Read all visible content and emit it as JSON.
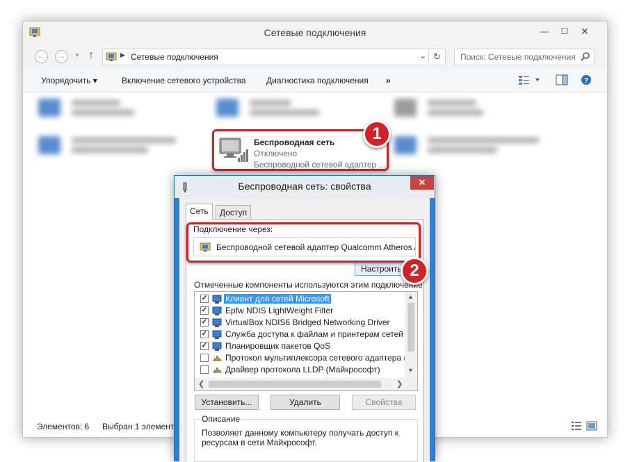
{
  "window": {
    "title": "Сетевые подключения",
    "minimize": "—",
    "maximize": "☐",
    "close": "✕"
  },
  "address": {
    "path": "Сетевые подключения",
    "search_placeholder": "Поиск: Сетевые подключения"
  },
  "toolbar": {
    "organize": "Упорядочить ▾",
    "enable_device": "Включение сетевого устройства",
    "diagnostics": "Диагностика подключения",
    "more": "»"
  },
  "selected_connection": {
    "name": "Беспроводная сеть",
    "status": "Отключено",
    "adapter": "Беспроводной сетевой адаптер ..."
  },
  "status_bar": {
    "count": "Элементов: 6",
    "selected": "Выбран 1 элемент"
  },
  "annotations": {
    "badge_1": "1",
    "badge_2": "2",
    "highlight_color": "#d32128"
  },
  "dialog": {
    "title": "Беспроводная сеть: свойства",
    "close": "✕",
    "tabs": [
      "Сеть",
      "Доступ"
    ],
    "connect_using_label": "Подключение через:",
    "adapter_name": "Беспроводной сетевой адаптер Qualcomm Atheros AR!",
    "configure_button": "Настроить...",
    "components_label": "Отмеченные компоненты используются этим подключением:",
    "components": [
      {
        "label": "Клиент для сетей Microsoft",
        "checked": true,
        "selected": true
      },
      {
        "label": "Epfw NDIS LightWeight Filter",
        "checked": true,
        "selected": false
      },
      {
        "label": "VirtualBox NDIS6 Bridged Networking Driver",
        "checked": true,
        "selected": false
      },
      {
        "label": "Служба доступа к файлам и принтерам сетей Micro",
        "checked": true,
        "selected": false
      },
      {
        "label": "Планировщик пакетов QoS",
        "checked": true,
        "selected": false
      },
      {
        "label": "Протокол мультиплексора сетевого адаптера (Май",
        "checked": false,
        "selected": false
      },
      {
        "label": "Драйвер протокола LLDP (Майкрософт)",
        "checked": false,
        "selected": false
      }
    ],
    "install_button": "Установить...",
    "remove_button": "Удалить",
    "properties_button": "Свойства",
    "description_title": "Описание",
    "description_text": "Позволяет данному компьютеру получать доступ к ресурсам в сети Майкрософт."
  }
}
